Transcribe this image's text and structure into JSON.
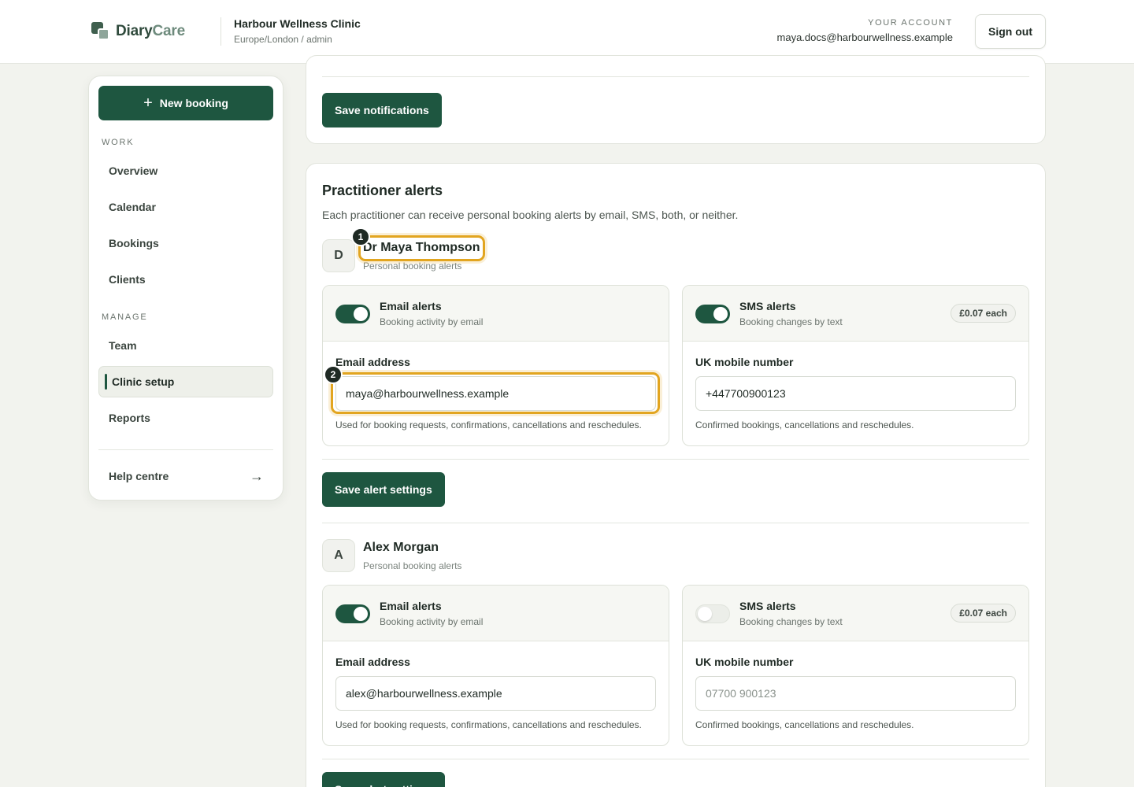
{
  "header": {
    "brand_part1": "Diary",
    "brand_part2": "Care",
    "clinic_name": "Harbour Wellness Clinic",
    "clinic_sub": "Europe/London / admin",
    "account_label": "YOUR ACCOUNT",
    "account_email": "maya.docs@harbourwellness.example",
    "sign_out": "Sign out"
  },
  "sidebar": {
    "new_booking": "New booking",
    "plus_glyph": "+",
    "work_label": "WORK",
    "manage_label": "MANAGE",
    "work_items": [
      "Overview",
      "Calendar",
      "Bookings",
      "Clients"
    ],
    "manage_items": [
      "Team",
      "Clinic setup",
      "Reports"
    ],
    "active_item": "Clinic setup",
    "help": "Help centre",
    "help_arrow": "→"
  },
  "notifications": {
    "save_label": "Save notifications"
  },
  "practitioner_alerts": {
    "title": "Practitioner alerts",
    "description": "Each practitioner can receive personal booking alerts by email, SMS, both, or neither.",
    "practitioners": [
      {
        "initial": "D",
        "name": "Dr Maya Thompson",
        "subtitle": "Personal booking alerts",
        "email": {
          "title": "Email alerts",
          "subtitle": "Booking activity by email",
          "enabled": true,
          "field_label": "Email address",
          "value": "maya@harbourwellness.example",
          "help": "Used for booking requests, confirmations, cancellations and reschedules."
        },
        "sms": {
          "title": "SMS alerts",
          "subtitle": "Booking changes by text",
          "enabled": true,
          "price": "£0.07 each",
          "field_label": "UK mobile number",
          "value": "+447700900123",
          "placeholder": "",
          "help": "Confirmed bookings, cancellations and reschedules."
        },
        "save_label": "Save alert settings"
      },
      {
        "initial": "A",
        "name": "Alex Morgan",
        "subtitle": "Personal booking alerts",
        "email": {
          "title": "Email alerts",
          "subtitle": "Booking activity by email",
          "enabled": true,
          "field_label": "Email address",
          "value": "alex@harbourwellness.example",
          "help": "Used for booking requests, confirmations, cancellations and reschedules."
        },
        "sms": {
          "title": "SMS alerts",
          "subtitle": "Booking changes by text",
          "enabled": false,
          "price": "£0.07 each",
          "field_label": "UK mobile number",
          "value": "",
          "placeholder": "07700 900123",
          "help": "Confirmed bookings, cancellations and reschedules."
        },
        "save_label": "Save alert settings"
      }
    ]
  },
  "callouts": [
    "1",
    "2"
  ],
  "colors": {
    "primary": "#1e5640",
    "highlight": "#e2a520",
    "background": "#f2f3ee"
  }
}
